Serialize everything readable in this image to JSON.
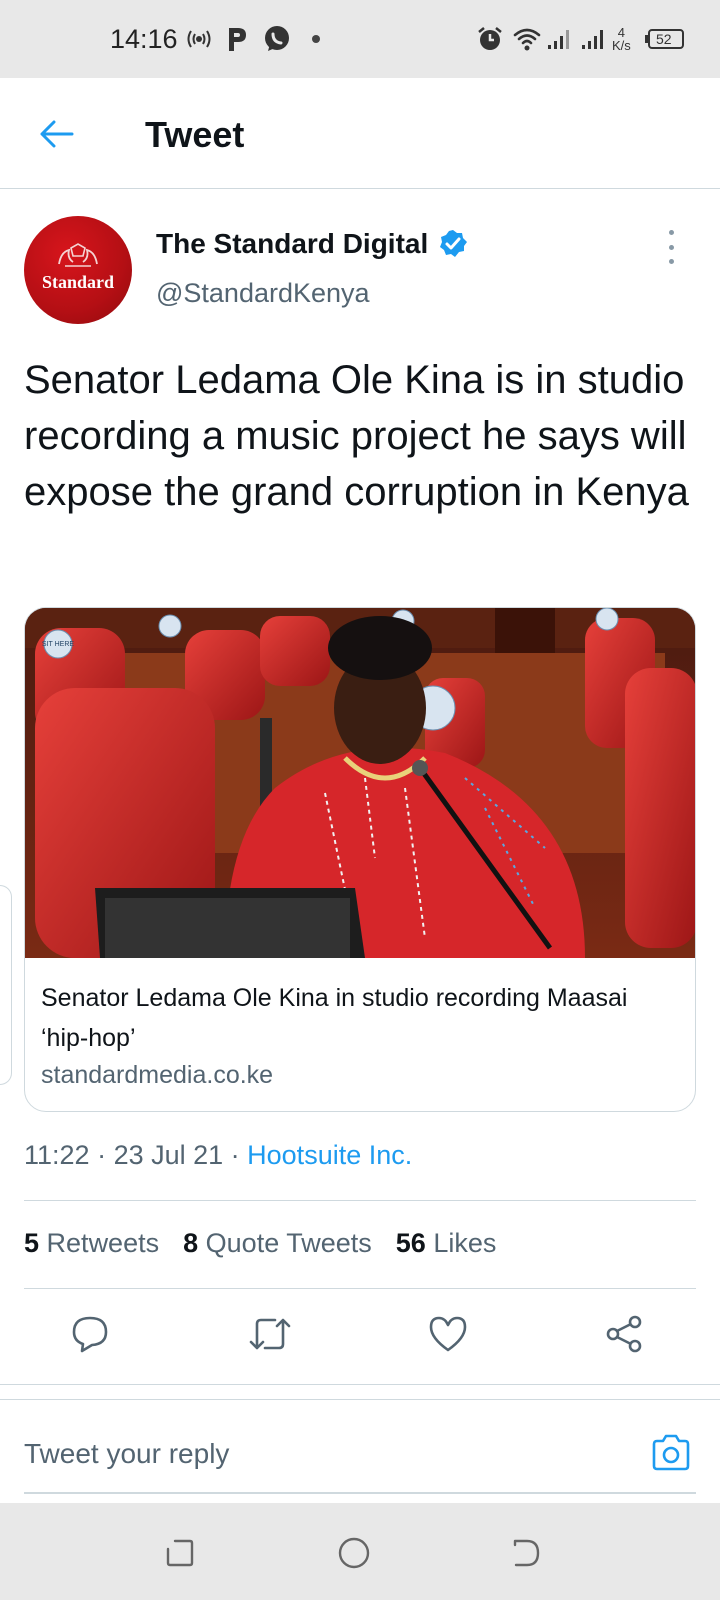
{
  "status_bar": {
    "time": "14:16",
    "network_speed": "4",
    "network_unit": "K/s",
    "battery": "52",
    "icons": [
      "hotspot-icon",
      "p-app-icon",
      "whatsapp-icon",
      "dot-icon",
      "alarm-icon",
      "wifi-icon",
      "signal-icon",
      "signal-icon",
      "battery-icon"
    ]
  },
  "header": {
    "title": "Tweet",
    "back_icon": "arrow-left-icon"
  },
  "author": {
    "name": "The Standard Digital",
    "handle": "@StandardKenya",
    "avatar_text": "Standard",
    "verified": true
  },
  "tweet": {
    "text": "Senator Ledama Ole Kina is in studio recording a music project he says will expose the grand corruption in Kenya"
  },
  "card": {
    "image_sign_text": "SIT HERE",
    "title": "Senator Ledama Ole Kina in studio recording Maasai ‘hip-hop’",
    "domain": "standardmedia.co.ke"
  },
  "meta": {
    "time": "11:22",
    "sep1": " · ",
    "date": "23 Jul 21",
    "sep2": " · ",
    "source": "Hootsuite Inc."
  },
  "stats": {
    "retweets_count": "5",
    "retweets_label": "Retweets",
    "quotes_count": "8",
    "quotes_label": "Quote Tweets",
    "likes_count": "56",
    "likes_label": "Likes"
  },
  "actions": [
    "reply-icon",
    "retweet-icon",
    "like-icon",
    "share-icon"
  ],
  "reply": {
    "placeholder": "Tweet your reply"
  },
  "colors": {
    "accent": "#1d9bf0",
    "text_secondary": "#536471",
    "border": "#cfd9de",
    "avatar_red": "#c0121a"
  }
}
